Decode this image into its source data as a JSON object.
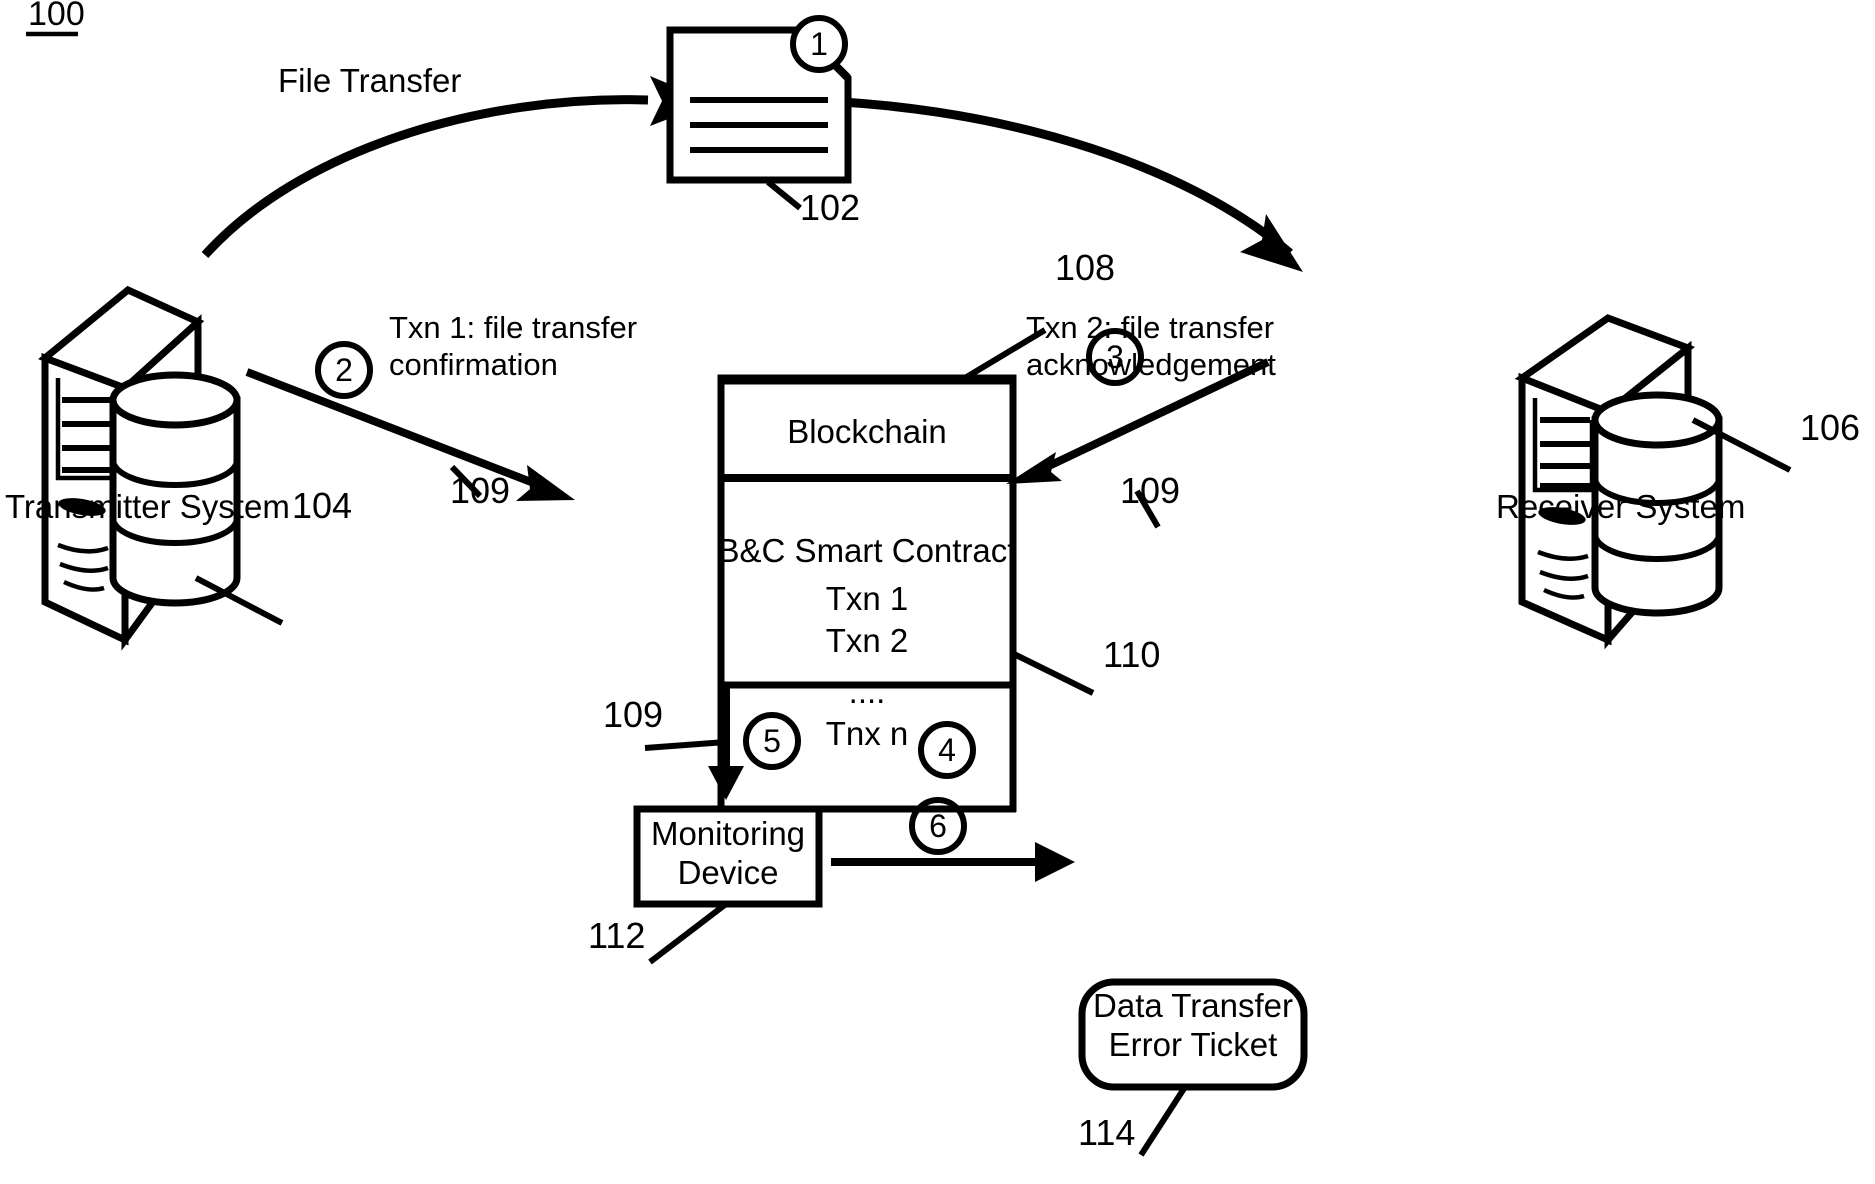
{
  "figure": {
    "number": "100",
    "title_label": "100"
  },
  "nodes": {
    "document": {
      "label": "",
      "ref": "102",
      "icon": "document-icon"
    },
    "transmitter": {
      "label": "Transmitter System",
      "ref": "104",
      "icon": "server-database-icon"
    },
    "receiver": {
      "label": "Receiver System",
      "ref": "106",
      "icon": "server-database-icon"
    },
    "blockchain": {
      "header": "Blockchain",
      "ref": "108",
      "contract_title": "B&C Smart Contract",
      "contract_ref": "110",
      "transactions": [
        "Txn 1",
        "Txn 2",
        "....",
        "Tnx n"
      ]
    },
    "monitoring_device": {
      "line1": "Monitoring",
      "line2": "Device",
      "ref": "112"
    },
    "error_ticket": {
      "line1": "Data Transfer",
      "line2": "Error Ticket",
      "ref": "114"
    }
  },
  "edges": {
    "file_transfer": {
      "label": "File Transfer",
      "marker": "1"
    },
    "txn1": {
      "line1": "Txn 1: file transfer",
      "line2": "confirmation",
      "marker": "2",
      "ref": "109"
    },
    "txn2": {
      "line1": "Txn 2: file transfer",
      "line2": "acknowledgement",
      "marker": "3",
      "ref": "109"
    },
    "contract_exec": {
      "marker": "4"
    },
    "to_monitoring": {
      "marker": "5",
      "ref": "109"
    },
    "to_ticket": {
      "marker": "6"
    }
  },
  "colors": {
    "stroke": "#000000",
    "background": "#ffffff"
  }
}
